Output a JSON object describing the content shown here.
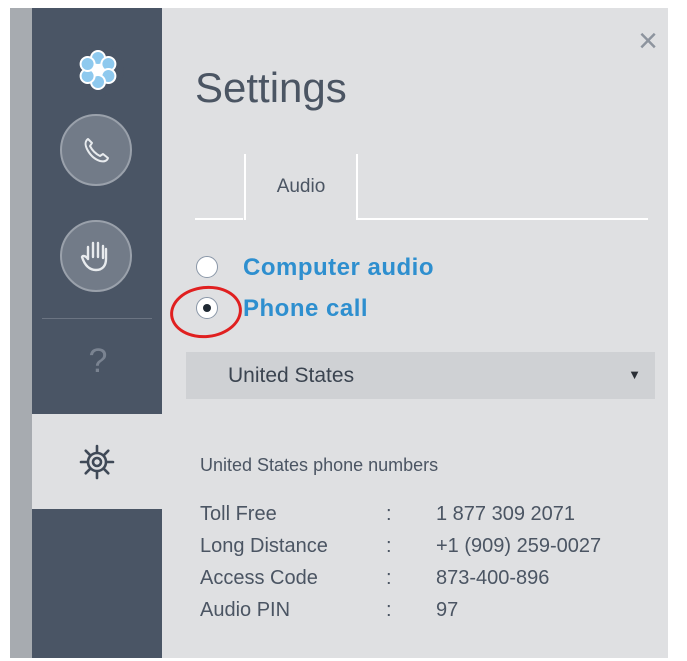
{
  "window": {
    "title": "Settings",
    "close_glyph": "×"
  },
  "sidebar": {
    "items": [
      {
        "name": "app-logo",
        "icon": "flower-logo-icon"
      },
      {
        "name": "phone",
        "icon": "phone-icon"
      },
      {
        "name": "raise-hand",
        "icon": "hand-icon"
      },
      {
        "name": "help",
        "icon": "question-icon",
        "glyph": "?"
      },
      {
        "name": "settings",
        "icon": "gear-icon",
        "active": true
      }
    ]
  },
  "tabs": [
    {
      "label": "Audio",
      "active": true
    }
  ],
  "audio": {
    "options": [
      {
        "label": "Computer audio",
        "selected": false
      },
      {
        "label": "Phone call",
        "selected": true
      }
    ],
    "country": {
      "selected": "United States",
      "caret": "▼"
    }
  },
  "phone_numbers": {
    "heading": "United States phone numbers",
    "separator": ":",
    "rows": [
      {
        "label": "Toll Free",
        "value": "1 877 309 2071"
      },
      {
        "label": "Long Distance",
        "value": "+1 (909) 259-0027"
      },
      {
        "label": "Access Code",
        "value": "873-400-896"
      },
      {
        "label": "Audio PIN",
        "value": "97"
      }
    ]
  },
  "colors": {
    "sidebar": "#4a5565",
    "panel": "#dfe0e2",
    "accent": "#2e8fcf",
    "highlight": "#e02020"
  }
}
